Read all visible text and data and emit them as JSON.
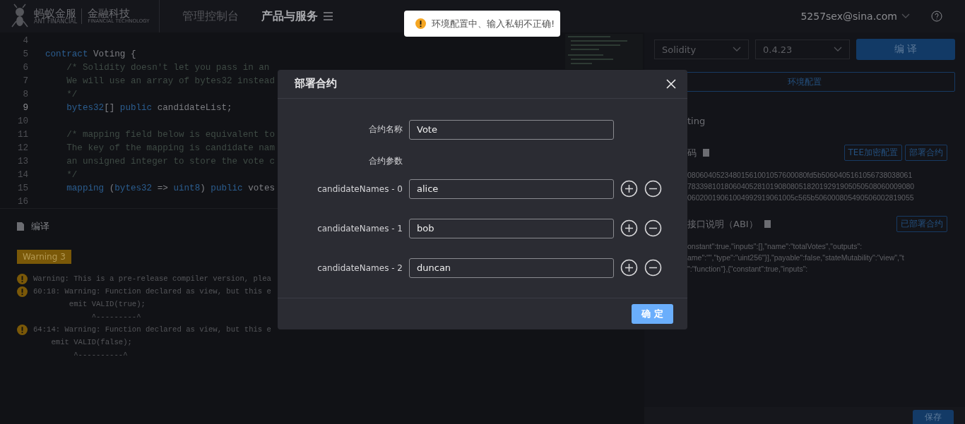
{
  "header": {
    "logo": {
      "cn": "蚂蚁金服",
      "en": "ANT FINANCIAL",
      "cn2": "金融科技",
      "en2": "FINANCIAL TECHNOLOGY"
    },
    "nav": [
      {
        "label": "管理控制台",
        "selected": false
      },
      {
        "label": "产品与服务",
        "selected": true
      }
    ],
    "user": "5257sex@sina.com"
  },
  "toast": {
    "message": "环境配置中、输入私钥不正确!"
  },
  "editor": {
    "lines": [
      {
        "number": "4",
        "active": false
      },
      {
        "number": "5",
        "active": false,
        "tokens": [
          {
            "text": "contract",
            "kind": "keyword"
          },
          {
            "text": " Voting {",
            "kind": "plain"
          }
        ]
      },
      {
        "number": "6",
        "active": false,
        "tokens": [
          {
            "text": "    /* Solidity doesn't let you pass in an",
            "kind": "comment"
          }
        ]
      },
      {
        "number": "7",
        "active": false,
        "tokens": [
          {
            "text": "    We will use an array of bytes32 instead",
            "kind": "comment"
          }
        ]
      },
      {
        "number": "8",
        "active": false,
        "tokens": [
          {
            "text": "    */",
            "kind": "comment"
          }
        ]
      },
      {
        "number": "9",
        "active": true,
        "tokens": [
          {
            "text": "    bytes32",
            "kind": "keyword"
          },
          {
            "text": "[] ",
            "kind": "plain"
          },
          {
            "text": "public",
            "kind": "keyword"
          },
          {
            "text": " candidateList;",
            "kind": "plain"
          }
        ]
      },
      {
        "number": "10",
        "active": false
      },
      {
        "number": "11",
        "active": false,
        "tokens": [
          {
            "text": "    /* mapping field below is equivalent to",
            "kind": "comment"
          }
        ]
      },
      {
        "number": "12",
        "active": false,
        "tokens": [
          {
            "text": "    The key of the mapping is candidate nam",
            "kind": "comment"
          }
        ]
      },
      {
        "number": "13",
        "active": false,
        "tokens": [
          {
            "text": "    an unsigned integer to store the vote c",
            "kind": "comment"
          }
        ]
      },
      {
        "number": "14",
        "active": false,
        "tokens": [
          {
            "text": "    */",
            "kind": "comment"
          }
        ]
      },
      {
        "number": "15",
        "active": false,
        "tokens": [
          {
            "text": "    mapping",
            "kind": "keyword"
          },
          {
            "text": " (",
            "kind": "plain"
          },
          {
            "text": "bytes32",
            "kind": "keyword"
          },
          {
            "text": " => ",
            "kind": "plain"
          },
          {
            "text": "uint8",
            "kind": "keyword"
          },
          {
            "text": ") ",
            "kind": "plain"
          },
          {
            "text": "public",
            "kind": "keyword"
          },
          {
            "text": " votes",
            "kind": "plain"
          }
        ]
      },
      {
        "number": "16",
        "active": false
      }
    ]
  },
  "compile": {
    "title": "编译",
    "tag": "Warning 3",
    "warnings": [
      {
        "message": "Warning: This is a pre-release compiler version, plea"
      },
      {
        "message": "60:18: Warning: Function declared as view, but this e",
        "details": [
          "        emit VALID(true);",
          "             ^---------^"
        ]
      },
      {
        "message": "64:14: Warning: Function declared as view, but this e",
        "details": [
          "    emit VALID(false);",
          "         ^----------^"
        ]
      }
    ]
  },
  "right": {
    "language": "Solidity",
    "version": "0.4.23",
    "compile_button": "编 译",
    "env_button": "环境配置",
    "contract": "ting",
    "bytecode": {
      "title": "码",
      "buttons": [
        "TEE加密配置",
        "部署合约"
      ],
      "lines": [
        "08060405234801561001057600080fd5b5060405161056738038061",
        "7833981018060405281019080805182019291905050508060009080",
        "06020019061004992919061005c565b506000805490506002819055"
      ]
    },
    "abi": {
      "title": "接口说明（ABI）",
      "button": "已部署合约",
      "lines": [
        "onstant\":true,\"inputs\":[],\"name\":\"totalVotes\",\"outputs\":",
        "ame\":\"\",\"type\":\"uint256\"}],\"payable\":false,\"stateMutability\":\"view\",\"t",
        "\":\"function\"},{\"constant\":true,\"inputs\":"
      ]
    },
    "save_button": "保存"
  },
  "modal": {
    "title": "部署合约",
    "name_label": "合约名称",
    "name_value": "Vote",
    "params_label": "合约参数",
    "params": [
      {
        "label": "candidateNames - 0",
        "value": "alice"
      },
      {
        "label": "candidateNames - 1",
        "value": "bob"
      },
      {
        "label": "candidateNames - 2",
        "value": "duncan"
      }
    ],
    "ok": "确 定"
  }
}
